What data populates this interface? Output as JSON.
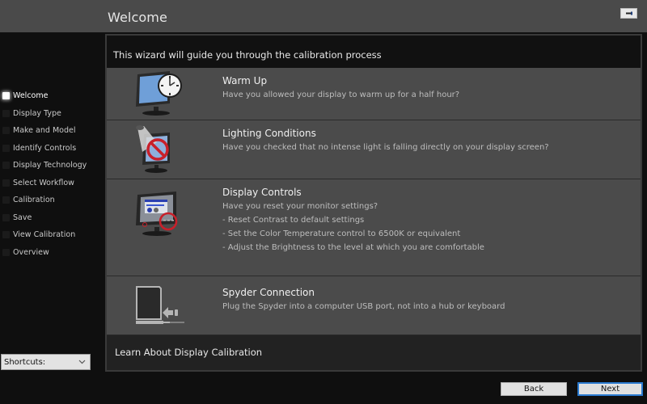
{
  "header": {
    "title": "Welcome",
    "collapse_icon": "collapse-arrow-icon"
  },
  "sidebar": {
    "items": [
      {
        "label": "Welcome",
        "active": true
      },
      {
        "label": "Display Type",
        "active": false
      },
      {
        "label": "Make and Model",
        "active": false
      },
      {
        "label": "Identify Controls",
        "active": false
      },
      {
        "label": "Display Technology",
        "active": false
      },
      {
        "label": "Select Workflow",
        "active": false
      },
      {
        "label": "Calibration",
        "active": false
      },
      {
        "label": "Save",
        "active": false
      },
      {
        "label": "View Calibration",
        "active": false
      },
      {
        "label": "Overview",
        "active": false
      }
    ],
    "shortcuts": {
      "selected": "Shortcuts:"
    }
  },
  "main": {
    "intro": "This wizard will guide you through the calibration process",
    "steps": [
      {
        "icon": "monitor-clock-icon",
        "title": "Warm Up",
        "lines": [
          "Have you allowed your display to warm up for a half hour?"
        ]
      },
      {
        "icon": "monitor-light-prohibited-icon",
        "title": "Lighting Conditions",
        "lines": [
          "Have you checked that no intense light is falling directly on your display screen?"
        ]
      },
      {
        "icon": "monitor-controls-icon",
        "title": "Display Controls",
        "lines": [
          "Have you reset your monitor settings?",
          "- Reset Contrast to default settings",
          "- Set the Color Temperature control to 6500K or equivalent",
          "- Adjust the Brightness to the level at which you are comfortable"
        ]
      },
      {
        "icon": "usb-connection-icon",
        "title": "Spyder Connection",
        "lines": [
          "Plug the Spyder into a computer USB port, not into a hub or keyboard"
        ]
      }
    ],
    "learn_link": "Learn About Display Calibration"
  },
  "footer": {
    "back_label": "Back",
    "next_label": "Next"
  },
  "colors": {
    "header_bg": "#4a4a4a",
    "step_bg": "#4b4b4b",
    "accent": "#2b7bd0",
    "prohibit_red": "#c8202a"
  }
}
